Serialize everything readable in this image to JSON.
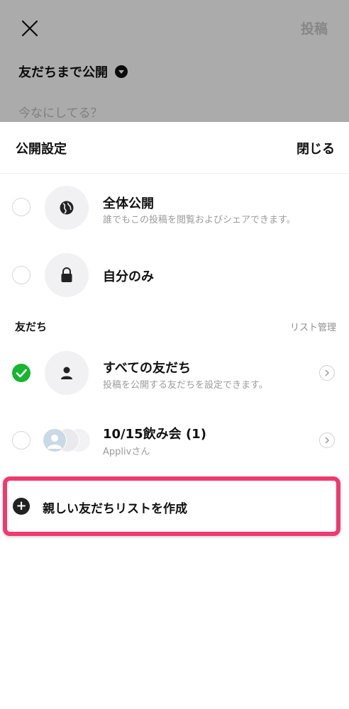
{
  "composer": {
    "post_label": "投稿",
    "audience_label": "友だちまで公開",
    "placeholder": "今なにしてる？"
  },
  "sheet": {
    "title": "公開設定",
    "close_label": "閉じる"
  },
  "options": [
    {
      "title": "全体公開",
      "subtitle": "誰でもこの投稿を閲覧およびシェアできます。",
      "icon": "globe-icon",
      "selected": false
    },
    {
      "title": "自分のみ",
      "subtitle": "",
      "icon": "lock-icon",
      "selected": false
    }
  ],
  "friends_section": {
    "label": "友だち",
    "manage_label": "リスト管理",
    "items": [
      {
        "title": "すべての友だち",
        "subtitle": "投稿を公開する友だちを設定できます。",
        "icon": "person-icon",
        "selected": true
      },
      {
        "title": "10/15飲み会 (1)",
        "subtitle": "Applivさん",
        "icon": "avatar-group",
        "selected": false
      }
    ]
  },
  "create_list": {
    "label": "親しい友だちリストを作成"
  },
  "colors": {
    "selected_green": "#17b530",
    "highlight_pink": "#f03a6f"
  }
}
